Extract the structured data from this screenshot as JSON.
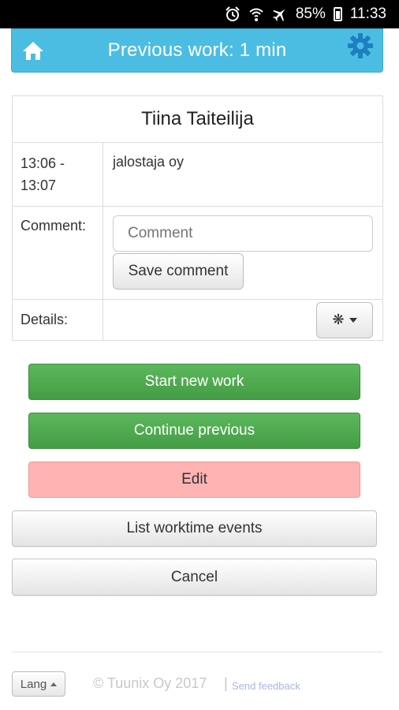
{
  "status_bar": {
    "battery": "85%",
    "time": "11:33",
    "icons": [
      "alarm-icon",
      "wifi-icon",
      "airplane-icon",
      "battery-icon"
    ]
  },
  "header": {
    "title": "Previous work: 1 min",
    "bg_color": "#4bbde3",
    "left_icon": "home-icon",
    "right_icon": "gear-icon"
  },
  "info": {
    "name": "Tiina Taiteilija",
    "time_start": "13:06 -",
    "time_end": "13:07",
    "company": "jalostaja oy",
    "comment_label": "Comment:",
    "comment_value": "",
    "comment_placeholder": "Comment",
    "save_comment_label": "Save comment",
    "details_label": "Details:",
    "details_button_glyph": "❋"
  },
  "actions": {
    "start_new": "Start new work",
    "continue_previous": "Continue previous",
    "edit": "Edit",
    "list_events": "List worktime events",
    "cancel": "Cancel"
  },
  "footer": {
    "lang_label": "Lang",
    "copyright": "© Tuunix Oy  2017",
    "separator": "|",
    "feedback_label": "Send feedback"
  },
  "colors": {
    "green": "#5cb85c",
    "pink": "#ffb3b3",
    "header": "#4bbde3"
  }
}
